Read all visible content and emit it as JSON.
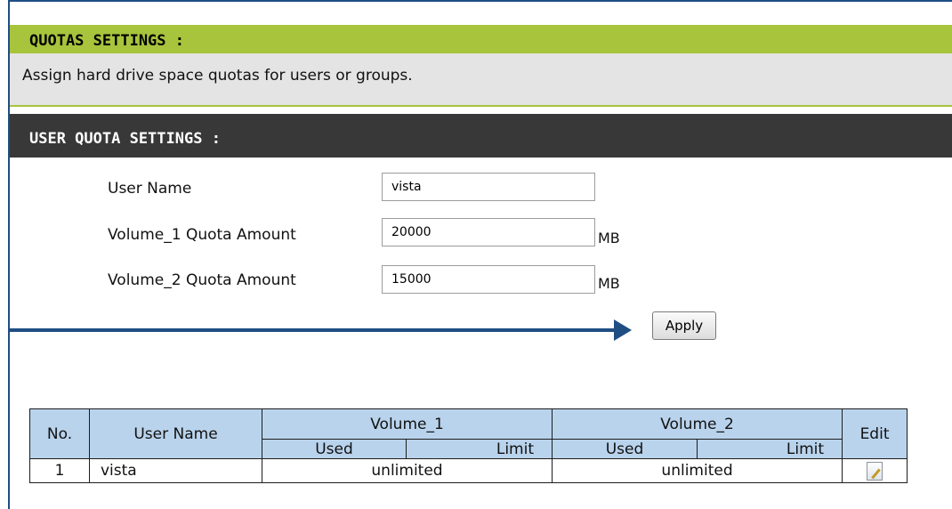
{
  "quotas": {
    "title": "QUOTAS SETTINGS :",
    "description": "Assign hard drive space quotas for users or groups."
  },
  "user_quota": {
    "title": "USER QUOTA SETTINGS :",
    "user_name_label": "User Name",
    "user_name_value": "vista",
    "volume1_label": "Volume_1 Quota Amount",
    "volume1_value": "20000",
    "volume1_unit": "MB",
    "volume2_label": "Volume_2 Quota Amount",
    "volume2_value": "15000",
    "volume2_unit": "MB",
    "apply_label": "Apply"
  },
  "table": {
    "headers": {
      "no": "No.",
      "user_name": "User Name",
      "volume1": "Volume_1",
      "volume2": "Volume_2",
      "used": "Used",
      "limit": "Limit",
      "edit": "Edit"
    },
    "rows": [
      {
        "no": "1",
        "user_name": "vista",
        "volume1": "unlimited",
        "volume2": "unlimited"
      }
    ]
  },
  "colors": {
    "section_green": "#a8c43c",
    "section_dark": "#383838",
    "table_header": "#b9d3ec",
    "arrow": "#1f4e83"
  },
  "icons": {
    "edit": "edit-document-icon"
  }
}
